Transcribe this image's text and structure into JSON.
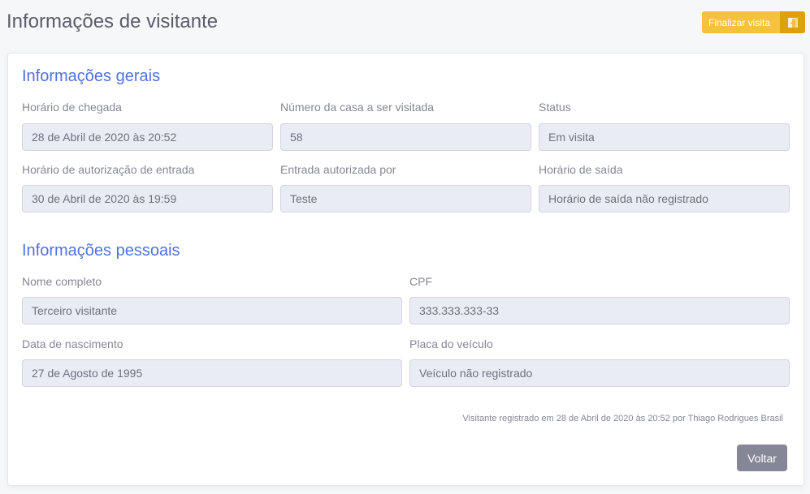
{
  "header": {
    "title": "Informações de visitante",
    "finish_label": "Finalizar visita"
  },
  "general": {
    "title": "Informações gerais",
    "arrival_label": "Horário de chegada",
    "arrival_value": "28 de Abril de 2020 às 20:52",
    "house_label": "Número da casa a ser visitada",
    "house_value": "58",
    "status_label": "Status",
    "status_value": "Em visita",
    "auth_time_label": "Horário de autorização de entrada",
    "auth_time_value": "30 de Abril de 2020 às 19:59",
    "auth_by_label": "Entrada autorizada por",
    "auth_by_value": "Teste",
    "exit_label": "Horário de saída",
    "exit_value": "Horário de saída não registrado"
  },
  "personal": {
    "title": "Informações pessoais",
    "name_label": "Nome completo",
    "name_value": "Terceiro visitante",
    "cpf_label": "CPF",
    "cpf_value": "333.333.333-33",
    "birth_label": "Data de nascimento",
    "birth_value": "27 de Agosto de 1995",
    "plate_label": "Placa do veículo",
    "plate_value": "Veículo não registrado"
  },
  "footer": {
    "note": "Visitante registrado em 28 de Abril de 2020 às 20:52 por Thiago Rodrigues Brasil",
    "back_label": "Voltar"
  }
}
